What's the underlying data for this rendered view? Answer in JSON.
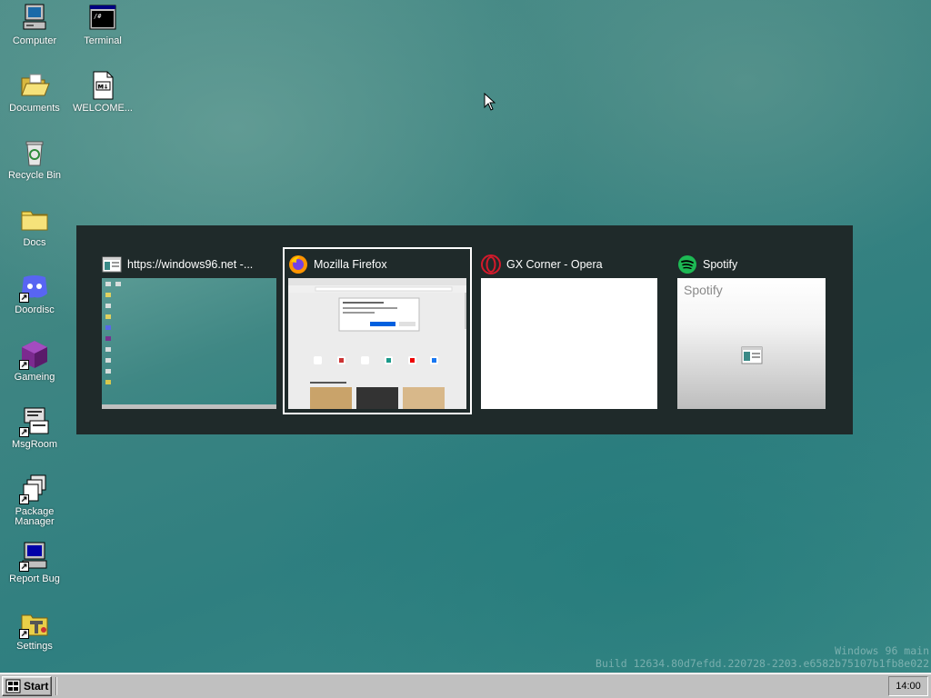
{
  "desktop": {
    "icons": [
      {
        "label": "Computer"
      },
      {
        "label": "Terminal"
      },
      {
        "label": "Documents"
      },
      {
        "label": "WELCOME..."
      },
      {
        "label": "Recycle Bin"
      },
      {
        "label": "Docs"
      },
      {
        "label": "Doordisc"
      },
      {
        "label": "Gameing"
      },
      {
        "label": "MsgRoom"
      },
      {
        "label": "Package Manager"
      },
      {
        "label": "Report Bug"
      },
      {
        "label": "Settings"
      }
    ]
  },
  "switcher": {
    "tasks": [
      {
        "title": "https://windows96.net -...",
        "icon": "window-icon"
      },
      {
        "title": "Mozilla Firefox",
        "icon": "firefox-icon",
        "selected": true
      },
      {
        "title": "GX Corner - Opera",
        "icon": "opera-icon"
      },
      {
        "title": "Spotify",
        "icon": "spotify-icon",
        "preview_text": "Spotify"
      }
    ]
  },
  "taskbar": {
    "start_label": "Start",
    "clock": "14:00"
  },
  "watermark": {
    "line1": "Windows 96 main",
    "line2": "Build 12634.80d7efdd.220728-2203.e6582b75107b1fb8e022"
  },
  "colors": {
    "switcher_bg": "#1f2a2a",
    "taskbar_bg": "#c0c0c0",
    "spotify_green": "#1db954",
    "opera_red": "#d21a2b"
  }
}
